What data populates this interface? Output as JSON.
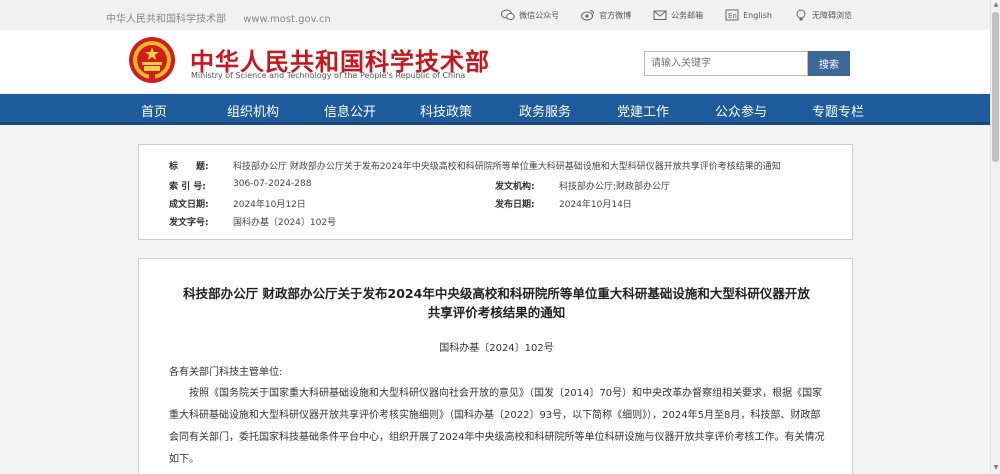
{
  "topbar": {
    "org_name": "中华人民共和国科学技术部",
    "url": "www.most.gov.cn",
    "links": [
      {
        "label": "微信公众号",
        "icon": "wechat-icon"
      },
      {
        "label": "官方微博",
        "icon": "weibo-icon"
      },
      {
        "label": "公务邮箱",
        "icon": "mail-icon"
      },
      {
        "label": "English",
        "icon": "english-icon"
      },
      {
        "label": "无障碍浏览",
        "icon": "accessibility-icon"
      }
    ]
  },
  "header": {
    "title": "中华人民共和国科学技术部",
    "subtitle": "Ministry of Science and Technology of the People's Republic of China",
    "search_placeholder": "请输入关键字",
    "search_button": "搜索"
  },
  "nav": [
    "首页",
    "组织机构",
    "信息公开",
    "科技政策",
    "政务服务",
    "党建工作",
    "公众参与",
    "专题专栏"
  ],
  "meta": {
    "title_label": "标　　题:",
    "title_value": "科技部办公厅 财政部办公厅关于发布2024年中央级高校和科研院所等单位重大科研基础设施和大型科研仪器开放共享评价考核结果的通知",
    "index_label": "索 引 号:",
    "index_value": "306-07-2024-288",
    "issuer_label": "发文机构:",
    "issuer_value": "科技部办公厅;财政部办公厅",
    "created_label": "成文日期:",
    "created_value": "2024年10月12日",
    "published_label": "发布日期:",
    "published_value": "2024年10月14日",
    "docno_label": "发文字号:",
    "docno_value": "国科办基〔2024〕102号"
  },
  "article": {
    "title_line1": "科技部办公厅 财政部办公厅关于发布2024年中央级高校和科研院所等单位重大科研基础设施和大型科研仪器开放",
    "title_line2": "共享评价考核结果的通知",
    "doc_number": "国科办基〔2024〕102号",
    "salutation": "各有关部门科技主管单位:",
    "paragraph": "按照《国务院关于国家重大科研基础设施和大型科研仪器向社会开放的意见》（国发〔2014〕70号）和中央改革办督察组相关要求，根据《国家重大科研基础设施和大型科研仪器开放共享评价考核实施细则》（国科办基〔2022〕93号，以下简称《细则》），2024年5月至8月，科技部、财政部会同有关部门，委托国家科技基础条件平台中心，组织开展了2024年中央级高校和科研院所等单位科研设施与仪器开放共享评价考核工作。有关情况如下。"
  },
  "colors": {
    "brand_red": "#c8161d",
    "nav_blue": "#1d5b9c",
    "search_blue": "#3c6996"
  }
}
